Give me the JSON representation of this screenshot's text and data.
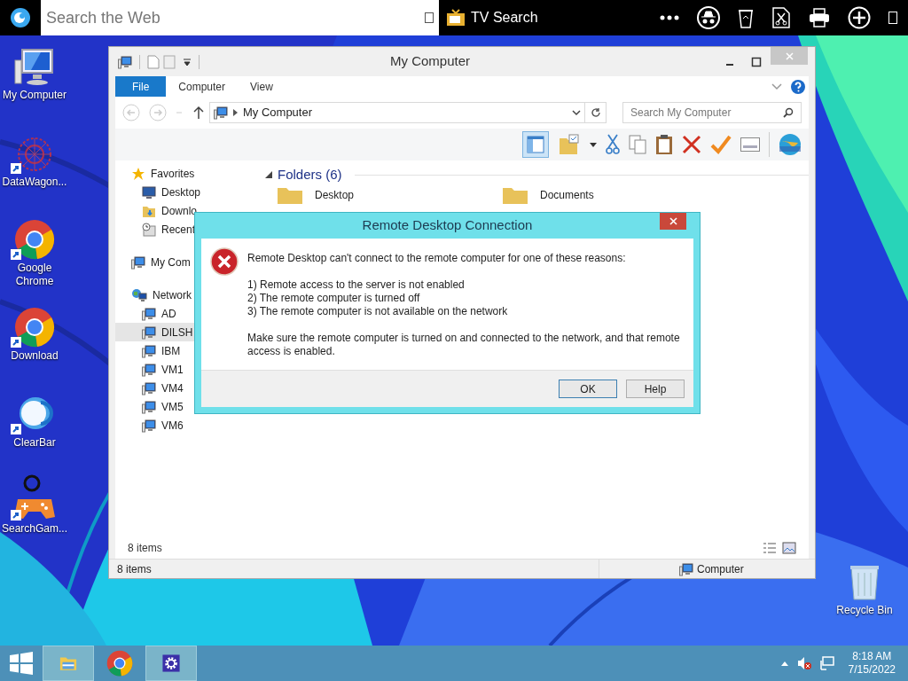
{
  "top_bar": {
    "search": {
      "placeholder": "Search the Web"
    },
    "tv_search": "TV Search"
  },
  "desktop_icons": [
    {
      "label": "My Computer",
      "kind": "computer",
      "shortcut": false
    },
    {
      "label": "DataWagon...",
      "kind": "web",
      "shortcut": true
    },
    {
      "label": "Google Chrome",
      "kind": "chrome",
      "shortcut": true
    },
    {
      "label": "Download",
      "kind": "chrome",
      "shortcut": true
    },
    {
      "label": "ClearBar",
      "kind": "clearbar",
      "shortcut": true
    },
    {
      "label": "SearchGam...",
      "kind": "gamepad",
      "shortcut": true
    }
  ],
  "recycle_bin": {
    "label": "Recycle Bin"
  },
  "explorer": {
    "title": "My Computer",
    "ribbon_tabs": [
      {
        "label": "File",
        "selected": true
      },
      {
        "label": "Computer",
        "selected": false
      },
      {
        "label": "View",
        "selected": false
      }
    ],
    "address": "My Computer",
    "search": {
      "placeholder": "Search My Computer"
    },
    "nav": [
      {
        "label": "Favorites",
        "kind": "star",
        "children": [
          {
            "label": "Desktop",
            "kind": "desktop",
            "selected": false
          },
          {
            "label": "Downlo",
            "kind": "downloads",
            "selected": false
          },
          {
            "label": "Recent",
            "kind": "recent",
            "selected": false
          }
        ]
      },
      {
        "label": "My Com",
        "kind": "computer"
      },
      {
        "label": "Network",
        "kind": "network",
        "children": [
          {
            "label": "AD",
            "kind": "computer",
            "selected": false
          },
          {
            "label": "DILSH",
            "kind": "computer",
            "selected": true
          },
          {
            "label": "IBM",
            "kind": "computer",
            "selected": false
          },
          {
            "label": "VM1",
            "kind": "computer",
            "selected": false
          },
          {
            "label": "VM4",
            "kind": "computer",
            "selected": false
          },
          {
            "label": "VM5",
            "kind": "computer",
            "selected": false
          },
          {
            "label": "VM6",
            "kind": "computer",
            "selected": false
          }
        ]
      }
    ],
    "folders_header": "Folders (6)",
    "folders": [
      {
        "label": "Desktop"
      },
      {
        "label": "Documents"
      }
    ],
    "item_count": "8 items",
    "status_bar": {
      "count": "8 items",
      "location": "Computer"
    }
  },
  "dialog": {
    "title": "Remote Desktop Connection",
    "message": "Remote Desktop can't connect to the remote computer for one of these reasons:",
    "reasons": [
      "1) Remote access to the server is not enabled",
      "2) The remote computer is turned off",
      "3) The remote computer is not available on the network"
    ],
    "advice": "Make sure the remote computer is turned on and connected to the network, and that remote access is enabled.",
    "buttons": [
      {
        "label": "OK",
        "default": true
      },
      {
        "label": "Help",
        "default": false
      }
    ]
  },
  "taskbar": {
    "apps": [
      {
        "kind": "explorer",
        "active": true
      },
      {
        "kind": "chrome",
        "active": false
      },
      {
        "kind": "settings",
        "active": true
      }
    ],
    "time": "8:18 AM",
    "date": "7/15/2022"
  }
}
